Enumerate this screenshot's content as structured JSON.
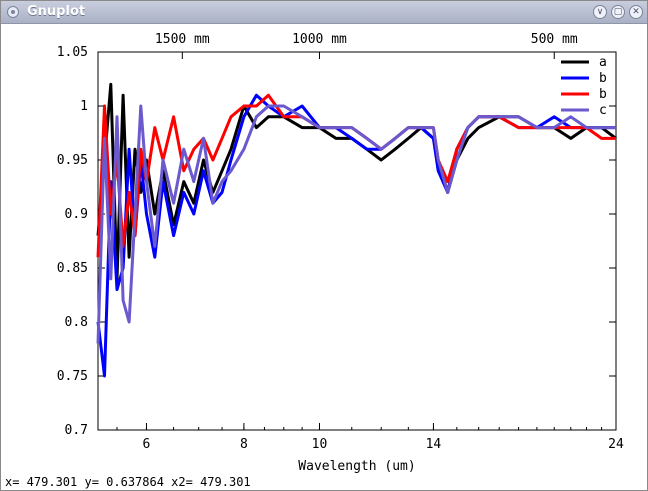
{
  "window": {
    "title": "Gnuplot",
    "controls": {
      "minimize": "∨",
      "maximize": "▢",
      "close": "✕"
    },
    "titlebar_color": "#aab1c6"
  },
  "chart_data": {
    "type": "line",
    "xlabel": "Wavelength (um)",
    "ylabel": "",
    "x_axis_scale": "log",
    "xlim": [
      5.2,
      24
    ],
    "ylim": [
      0.7,
      1.05
    ],
    "x_ticks": [
      {
        "value": 6,
        "label": "6"
      },
      {
        "value": 8,
        "label": "8"
      },
      {
        "value": 10,
        "label": "10"
      },
      {
        "value": 14,
        "label": "14"
      },
      {
        "value": 24,
        "label": "24"
      }
    ],
    "y_ticks": [
      {
        "value": 0.7,
        "label": "0.7"
      },
      {
        "value": 0.75,
        "label": "0.75"
      },
      {
        "value": 0.8,
        "label": "0.8"
      },
      {
        "value": 0.85,
        "label": "0.85"
      },
      {
        "value": 0.9,
        "label": "0.9"
      },
      {
        "value": 0.95,
        "label": "0.95"
      },
      {
        "value": 1.0,
        "label": "1"
      },
      {
        "value": 1.05,
        "label": "1.05"
      }
    ],
    "x2_ticks": [
      {
        "value": 6.67,
        "label": "1500 mm"
      },
      {
        "value": 10.0,
        "label": "1000 mm"
      },
      {
        "value": 20.0,
        "label": "500 mm"
      }
    ],
    "grid": false,
    "legend_position": "top-right",
    "series": [
      {
        "name": "a",
        "color": "#000000",
        "x": [
          5.2,
          5.3,
          5.4,
          5.5,
          5.6,
          5.7,
          5.8,
          5.9,
          6.0,
          6.15,
          6.3,
          6.5,
          6.7,
          6.9,
          7.1,
          7.3,
          7.5,
          7.7,
          8.0,
          8.3,
          8.6,
          9.0,
          9.5,
          10.0,
          10.5,
          11.0,
          11.5,
          12.0,
          12.5,
          13.0,
          13.5,
          14.0,
          14.2,
          14.6,
          15.0,
          15.5,
          16.0,
          17.0,
          18.0,
          19.0,
          20.0,
          21.0,
          22.0,
          23.0,
          24.0
        ],
        "y": [
          0.88,
          0.95,
          1.02,
          0.84,
          1.01,
          0.86,
          0.96,
          0.92,
          0.95,
          0.9,
          0.94,
          0.89,
          0.93,
          0.91,
          0.95,
          0.92,
          0.94,
          0.96,
          1.0,
          0.98,
          0.99,
          0.99,
          0.98,
          0.98,
          0.97,
          0.97,
          0.96,
          0.95,
          0.96,
          0.97,
          0.98,
          0.97,
          0.95,
          0.92,
          0.95,
          0.97,
          0.98,
          0.99,
          0.99,
          0.98,
          0.98,
          0.97,
          0.98,
          0.98,
          0.97
        ]
      },
      {
        "name": "b",
        "color": "#0000ff",
        "x": [
          5.2,
          5.3,
          5.4,
          5.5,
          5.6,
          5.7,
          5.8,
          5.9,
          6.0,
          6.15,
          6.3,
          6.5,
          6.7,
          6.9,
          7.1,
          7.3,
          7.5,
          7.7,
          8.0,
          8.3,
          8.6,
          9.0,
          9.5,
          10.0,
          10.5,
          11.0,
          11.5,
          12.0,
          12.5,
          13.0,
          13.5,
          14.0,
          14.2,
          14.6,
          15.0,
          15.5,
          16.0,
          17.0,
          18.0,
          19.0,
          20.0,
          21.0,
          22.0,
          23.0,
          24.0
        ],
        "y": [
          0.8,
          0.75,
          0.93,
          0.83,
          0.85,
          0.96,
          0.88,
          0.95,
          0.9,
          0.86,
          0.93,
          0.88,
          0.92,
          0.9,
          0.94,
          0.91,
          0.92,
          0.95,
          0.99,
          1.01,
          1.0,
          0.99,
          1.0,
          0.98,
          0.98,
          0.97,
          0.96,
          0.96,
          0.97,
          0.98,
          0.98,
          0.97,
          0.94,
          0.92,
          0.96,
          0.98,
          0.99,
          0.99,
          0.98,
          0.98,
          0.99,
          0.98,
          0.98,
          0.98,
          0.98
        ]
      },
      {
        "name": "b",
        "color": "#ff0000",
        "x": [
          5.2,
          5.3,
          5.4,
          5.5,
          5.6,
          5.7,
          5.8,
          5.9,
          6.0,
          6.15,
          6.3,
          6.5,
          6.7,
          6.9,
          7.1,
          7.3,
          7.5,
          7.7,
          8.0,
          8.3,
          8.6,
          9.0,
          9.5,
          10.0,
          10.5,
          11.0,
          11.5,
          12.0,
          12.5,
          13.0,
          13.5,
          14.0,
          14.2,
          14.6,
          15.0,
          15.5,
          16.0,
          17.0,
          18.0,
          19.0,
          20.0,
          21.0,
          22.0,
          23.0,
          24.0
        ],
        "y": [
          0.86,
          1.0,
          0.9,
          0.95,
          0.87,
          0.92,
          0.88,
          0.96,
          0.93,
          0.98,
          0.95,
          0.99,
          0.94,
          0.96,
          0.97,
          0.95,
          0.97,
          0.99,
          1.0,
          1.0,
          1.01,
          0.99,
          0.99,
          0.98,
          0.98,
          0.98,
          0.97,
          0.96,
          0.97,
          0.98,
          0.98,
          0.98,
          0.95,
          0.93,
          0.96,
          0.98,
          0.99,
          0.99,
          0.98,
          0.98,
          0.98,
          0.98,
          0.98,
          0.97,
          0.97
        ]
      },
      {
        "name": "c",
        "color": "#6a5acd",
        "x": [
          5.2,
          5.3,
          5.4,
          5.5,
          5.6,
          5.7,
          5.8,
          5.9,
          6.0,
          6.15,
          6.3,
          6.5,
          6.7,
          6.9,
          7.1,
          7.3,
          7.5,
          7.7,
          8.0,
          8.3,
          8.6,
          9.0,
          9.5,
          10.0,
          10.5,
          11.0,
          11.5,
          12.0,
          12.5,
          13.0,
          13.5,
          14.0,
          14.2,
          14.6,
          15.0,
          15.5,
          16.0,
          17.0,
          18.0,
          19.0,
          20.0,
          21.0,
          22.0,
          23.0,
          24.0
        ],
        "y": [
          0.78,
          0.97,
          0.84,
          0.99,
          0.82,
          0.8,
          0.9,
          1.0,
          0.93,
          0.87,
          0.95,
          0.91,
          0.96,
          0.93,
          0.97,
          0.91,
          0.93,
          0.94,
          0.96,
          0.99,
          1.0,
          1.0,
          0.99,
          0.98,
          0.98,
          0.98,
          0.97,
          0.96,
          0.97,
          0.98,
          0.98,
          0.98,
          0.95,
          0.92,
          0.95,
          0.98,
          0.99,
          0.99,
          0.99,
          0.98,
          0.98,
          0.99,
          0.98,
          0.98,
          0.98
        ]
      }
    ]
  },
  "status_bar": {
    "text": "x= 479.301 y= 0.637864 x2= 479.301"
  }
}
